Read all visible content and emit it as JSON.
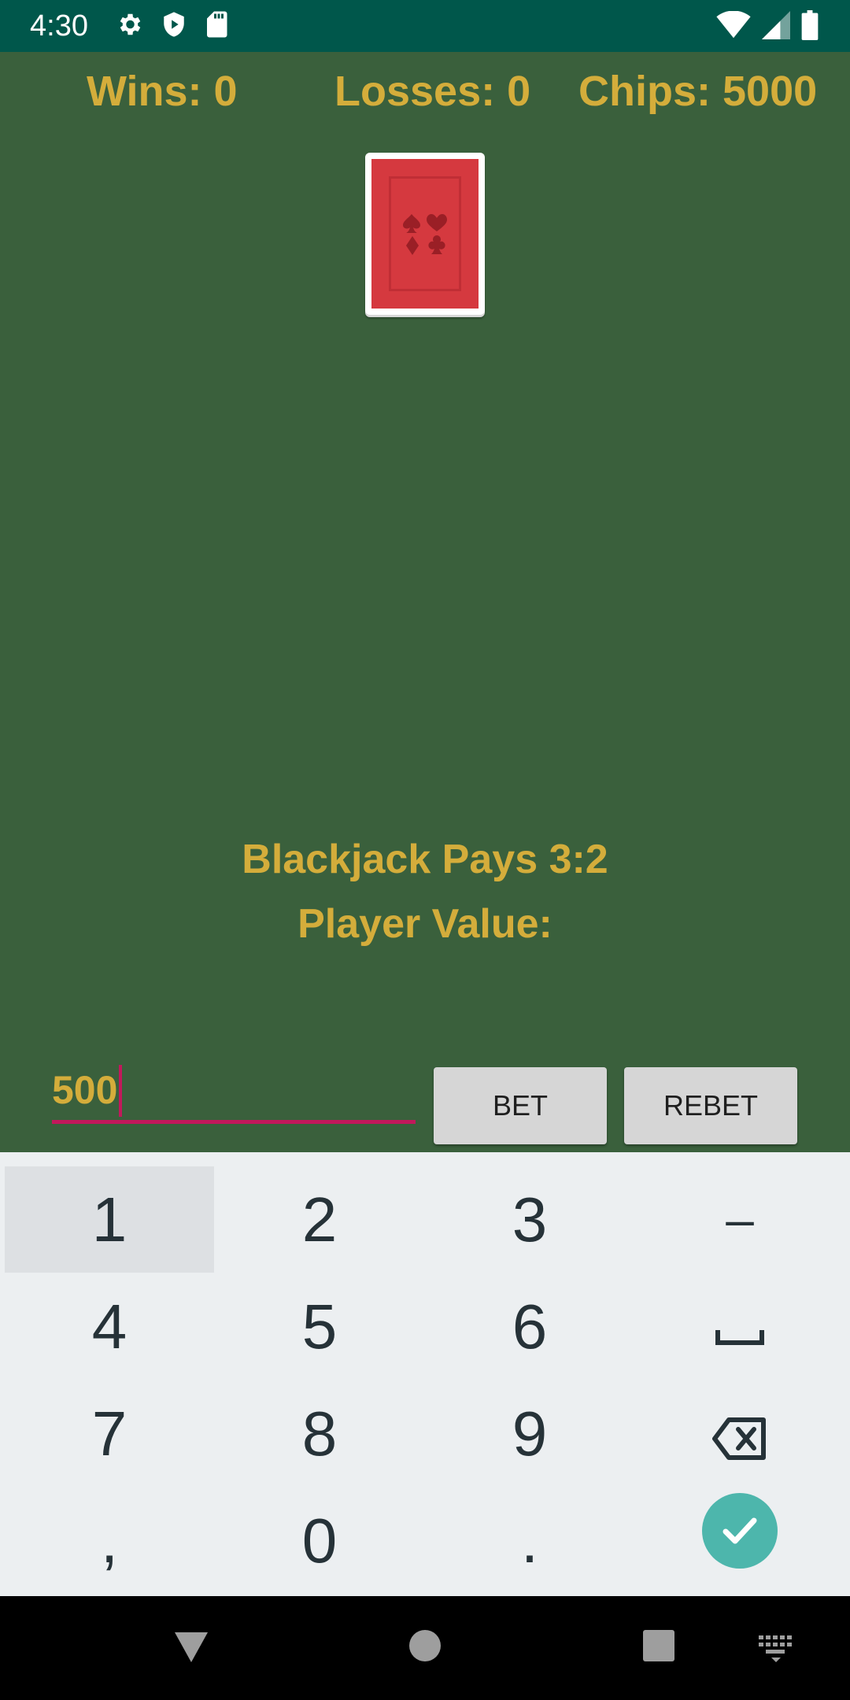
{
  "status_bar": {
    "time": "4:30"
  },
  "stats": {
    "wins_label": "Wins:",
    "wins_value": "0",
    "losses_label": "Losses:",
    "losses_value": "0",
    "chips_label": "Chips:",
    "chips_value": "5000"
  },
  "table": {
    "card_state": "face-down",
    "blackjack_text": "Blackjack Pays 3:2",
    "player_value_text": "Player Value:"
  },
  "bet": {
    "input_value": "500",
    "bet_label": "BET",
    "rebet_label": "REBET"
  },
  "keyboard": {
    "keys": [
      "1",
      "2",
      "3",
      "–",
      "4",
      "5",
      "6",
      "␣",
      "7",
      "8",
      "9",
      "⌫",
      ",",
      "0",
      ".",
      "✓"
    ]
  },
  "colors": {
    "felt": "#3a603c",
    "status_bar": "#00574b",
    "gold_text": "#d4ad3b",
    "accent": "#c2185b",
    "card_back": "#d5393f",
    "confirm_button": "#4db6ac"
  }
}
